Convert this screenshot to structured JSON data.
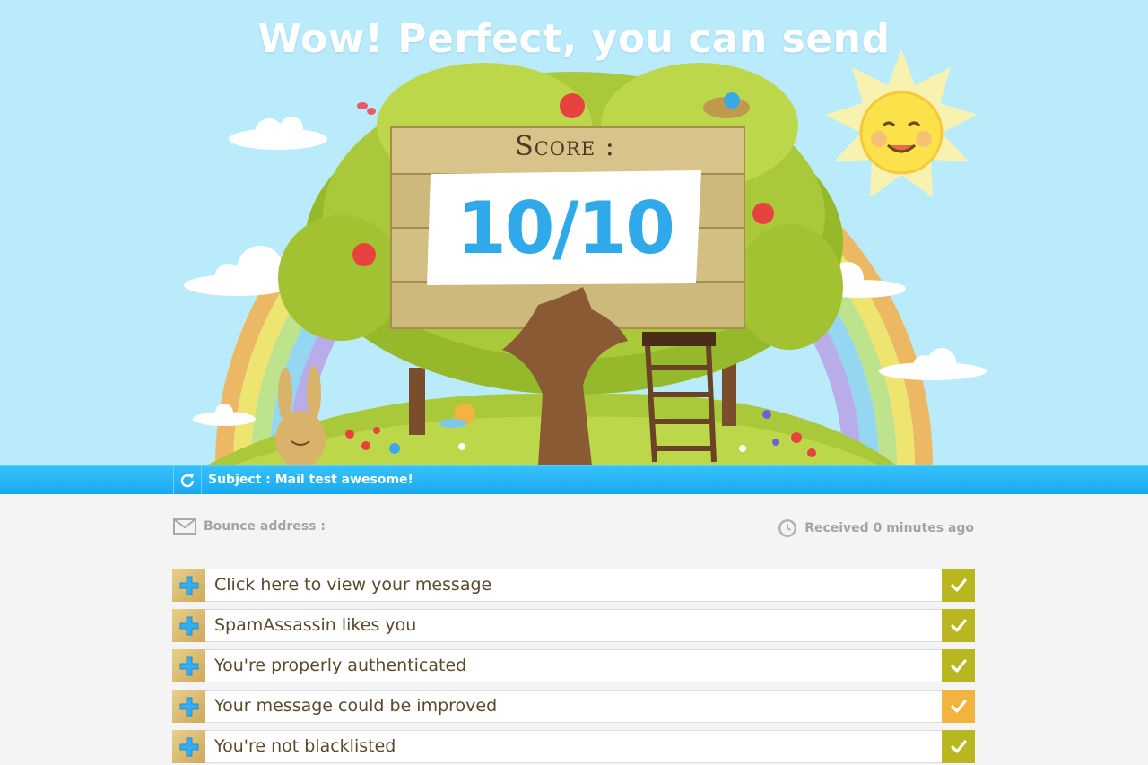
{
  "hero": {
    "headline": "Wow! Perfect, you can send",
    "score_label": "Score :",
    "score_value": "10/10"
  },
  "subject_bar": {
    "subject": "Subject : Mail test awesome!",
    "refresh_icon": "refresh-icon"
  },
  "info": {
    "bounce_label": "Bounce address :",
    "bounce_icon": "envelope-icon",
    "received_text": "Received 0 minutes ago",
    "received_icon": "clock-icon"
  },
  "checks": [
    {
      "label": "Click here to view your message",
      "status": "pass",
      "status_color": "#b9b71f"
    },
    {
      "label": "SpamAssassin likes you",
      "status": "pass",
      "status_color": "#b9b71f"
    },
    {
      "label": "You're properly authenticated",
      "status": "pass",
      "status_color": "#b9b71f"
    },
    {
      "label": "Your message could be improved",
      "status": "warning",
      "status_color": "#f3b33f"
    },
    {
      "label": "You're not blacklisted",
      "status": "pass",
      "status_color": "#b9b71f"
    }
  ],
  "colors": {
    "sky": "#b9ebfb",
    "accent_blue": "#2fa9ea",
    "pass_green": "#b9b71f",
    "warn_orange": "#f3b33f"
  }
}
